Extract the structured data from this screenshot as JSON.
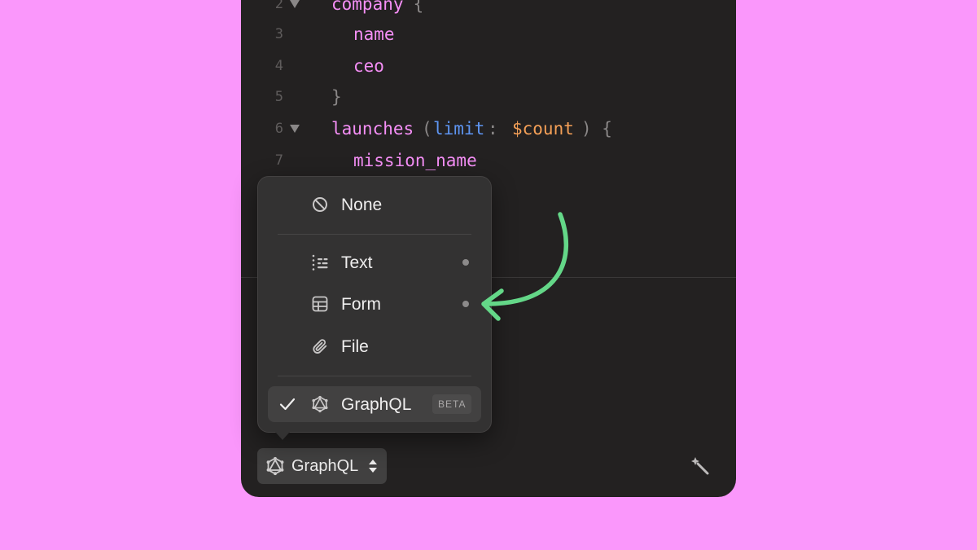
{
  "editor": {
    "lines": [
      {
        "number": "2",
        "folded": true,
        "tokens": [
          {
            "text": "company",
            "kind": "field"
          },
          {
            "text": " {",
            "kind": "punct"
          }
        ]
      },
      {
        "number": "3",
        "folded": false,
        "tokens": [
          {
            "text": "name",
            "kind": "field"
          }
        ]
      },
      {
        "number": "4",
        "folded": false,
        "tokens": [
          {
            "text": "ceo",
            "kind": "field"
          }
        ]
      },
      {
        "number": "5",
        "folded": false,
        "tokens": [
          {
            "text": "}",
            "kind": "punct"
          }
        ]
      },
      {
        "number": "6",
        "folded": true,
        "tokens": [
          {
            "text": "launches",
            "kind": "field"
          },
          {
            "text": "(",
            "kind": "punct"
          },
          {
            "text": "limit",
            "kind": "arg"
          },
          {
            "text": ": ",
            "kind": "punct"
          },
          {
            "text": "$count",
            "kind": "var"
          },
          {
            "text": ") {",
            "kind": "punct"
          }
        ]
      },
      {
        "number": "7",
        "folded": false,
        "tokens": [
          {
            "text": "mission_name",
            "kind": "field"
          }
        ]
      }
    ]
  },
  "menu": {
    "items": [
      {
        "label": "None",
        "icon": "none-icon"
      },
      {
        "label": "Text",
        "icon": "text-icon"
      },
      {
        "label": "Form",
        "icon": "form-icon"
      },
      {
        "label": "File",
        "icon": "paperclip-icon"
      },
      {
        "label": "GraphQL",
        "icon": "graphql-icon",
        "badge": "BETA",
        "selected": true
      }
    ]
  },
  "toolbar": {
    "body_type_label": "GraphQL",
    "body_type_icon": "graphql-icon",
    "sort_icon": "sort-icon",
    "action_icon": "magic-wand-icon"
  },
  "colors": {
    "background": "#fa97fb",
    "editor_bg": "#232121",
    "field": "#f58ff6",
    "arg": "#5e95f2",
    "var": "#f5a057",
    "arrow": "#64d788"
  }
}
